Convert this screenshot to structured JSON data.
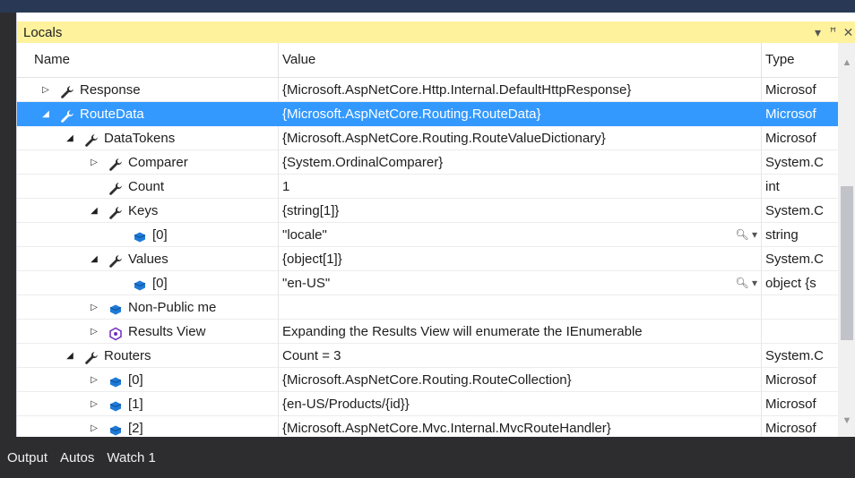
{
  "panel": {
    "title": "Locals"
  },
  "columns": {
    "name": "Name",
    "value": "Value",
    "type": "Type"
  },
  "rows": [
    {
      "name": "Response",
      "value": "{Microsoft.AspNetCore.Http.Internal.DefaultHttpResponse}",
      "type": "Microsof",
      "expander": "collapsed",
      "icon": "wrench-icon",
      "depth": 0
    },
    {
      "name": "RouteData",
      "value": "{Microsoft.AspNetCore.Routing.RouteData}",
      "type": "Microsof",
      "expander": "expanded",
      "icon": "wrench-icon",
      "depth": 0,
      "selected": true
    },
    {
      "name": "DataTokens",
      "value": "{Microsoft.AspNetCore.Routing.RouteValueDictionary}",
      "type": "Microsof",
      "expander": "expanded",
      "icon": "wrench-icon",
      "depth": 1
    },
    {
      "name": "Comparer",
      "value": "{System.OrdinalComparer}",
      "type": "System.C",
      "expander": "collapsed",
      "icon": "wrench-icon",
      "depth": 2
    },
    {
      "name": "Count",
      "value": "1",
      "type": "int",
      "expander": "none",
      "icon": "wrench-icon",
      "depth": 2
    },
    {
      "name": "Keys",
      "value": "{string[1]}",
      "type": "System.C",
      "expander": "expanded",
      "icon": "wrench-icon",
      "depth": 2
    },
    {
      "name": "[0]",
      "value": "\"locale\"",
      "type": "string",
      "expander": "none",
      "icon": "field-icon",
      "depth": 3,
      "visualizer": true
    },
    {
      "name": "Values",
      "value": "{object[1]}",
      "type": "System.C",
      "expander": "expanded",
      "icon": "wrench-icon",
      "depth": 2
    },
    {
      "name": "[0]",
      "value": "\"en-US\"",
      "type": "object {s",
      "expander": "none",
      "icon": "field-icon",
      "depth": 3,
      "visualizer": true
    },
    {
      "name": "Non-Public me",
      "value": "",
      "type": "",
      "expander": "collapsed",
      "icon": "field-icon",
      "depth": 2
    },
    {
      "name": "Results View",
      "value": "Expanding the Results View will enumerate the IEnumerable",
      "type": "",
      "expander": "collapsed",
      "icon": "results-view-icon",
      "depth": 2
    },
    {
      "name": "Routers",
      "value": "Count = 3",
      "type": "System.C",
      "expander": "expanded",
      "icon": "wrench-icon",
      "depth": 1
    },
    {
      "name": "[0]",
      "value": "{Microsoft.AspNetCore.Routing.RouteCollection}",
      "type": "Microsof",
      "expander": "collapsed",
      "icon": "field-icon",
      "depth": 2
    },
    {
      "name": "[1]",
      "value": "{en-US/Products/{id}}",
      "type": "Microsof",
      "expander": "collapsed",
      "icon": "field-icon",
      "depth": 2
    },
    {
      "name": "[2]",
      "value": "{Microsoft.AspNetCore.Mvc.Internal.MvcRouteHandler}",
      "type": "Microsof",
      "expander": "collapsed",
      "icon": "field-icon",
      "depth": 2
    }
  ],
  "bottom_tabs": [
    "Output",
    "Autos",
    "Watch 1"
  ],
  "colors": {
    "title_bar": "#fff29d",
    "selection": "#3399ff",
    "frame": "#2d2d30"
  }
}
